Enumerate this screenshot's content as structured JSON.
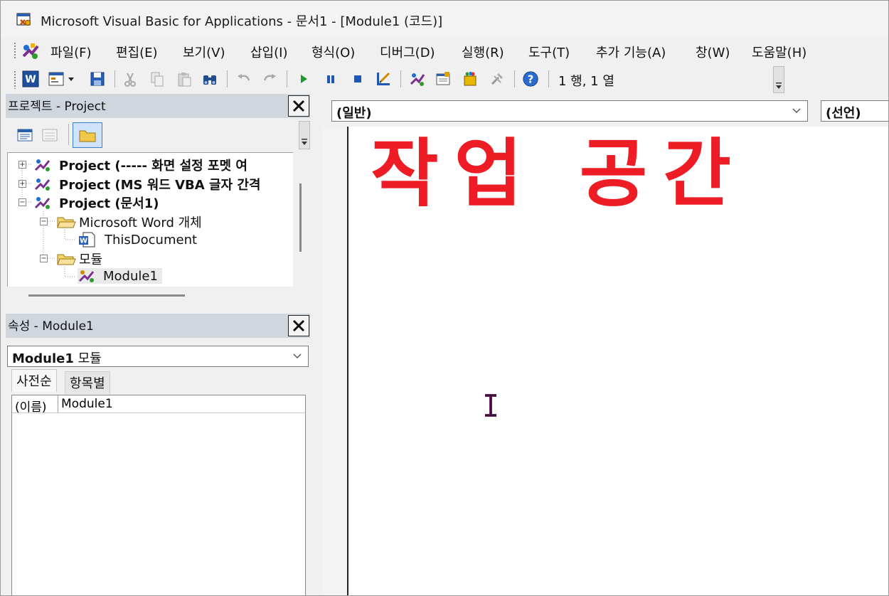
{
  "window": {
    "title": "Microsoft Visual Basic for Applications - 문서1 - [Module1 (코드)]"
  },
  "menu": {
    "items": [
      "파일(F)",
      "편집(E)",
      "보기(V)",
      "삽입(I)",
      "형식(O)",
      "디버그(D)",
      "실행(R)",
      "도구(T)",
      "추가 기능(A)",
      "창(W)",
      "도움말(H)"
    ]
  },
  "toolbar": {
    "position_text": "1 행, 1 열",
    "icons": [
      "word-icon",
      "insert-userform-icon",
      "dropdown-arrow-icon",
      "save-icon",
      "cut-icon",
      "copy-icon",
      "paste-icon",
      "find-icon",
      "undo-icon",
      "redo-icon",
      "run-icon",
      "break-icon",
      "reset-icon",
      "design-mode-icon",
      "project-explorer-icon",
      "properties-window-icon",
      "object-browser-icon",
      "toolbox-icon",
      "help-icon"
    ]
  },
  "project_pane": {
    "title": "프로젝트 - Project",
    "tree": [
      {
        "label": "Project (----- 화면 설정 포멧 여",
        "bold": true
      },
      {
        "label": "Project (MS 워드 VBA 글자 간격",
        "bold": true
      },
      {
        "label": "Project (문서1)",
        "bold": true
      },
      {
        "label": "Microsoft Word 개체",
        "bold": false
      },
      {
        "label": "ThisDocument",
        "bold": false
      },
      {
        "label": "모듈",
        "bold": false
      },
      {
        "label": "Module1",
        "bold": false
      }
    ]
  },
  "properties_pane": {
    "title": "속성 - Module1",
    "selected_object_name": "Module1",
    "selected_object_type": "모듈",
    "tabs": [
      "사전순",
      "항목별"
    ],
    "rows": [
      {
        "name": "(이름)",
        "value": "Module1"
      }
    ]
  },
  "code_pane": {
    "object_combo": "(일반)",
    "procedure_combo": "(선언)",
    "annotation": "작업 공간"
  },
  "colors": {
    "annotation": "#ee1c25",
    "pane_header": "#cfd6de"
  }
}
